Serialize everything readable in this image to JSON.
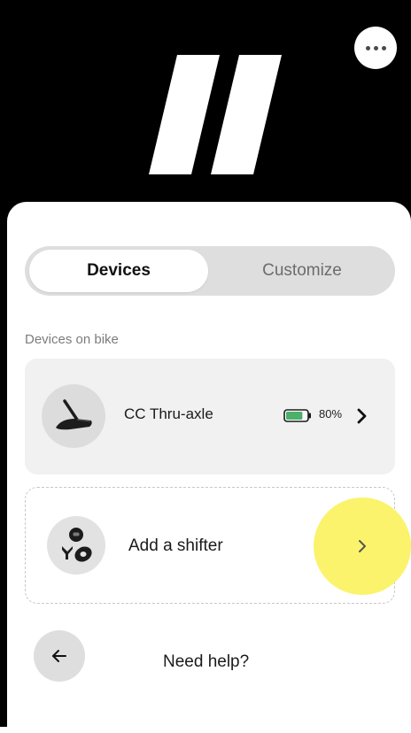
{
  "header": {
    "more_icon": "more-horizontal-icon",
    "logo_icon": "brand-logo-icon"
  },
  "tabs": {
    "items": [
      {
        "label": "Devices",
        "active": true
      },
      {
        "label": "Customize",
        "active": false
      }
    ]
  },
  "devices_section": {
    "label": "Devices on bike",
    "devices": [
      {
        "name": "CC Thru-axle",
        "battery_percent": 80,
        "battery_text": "80%",
        "icon": "thru-axle-icon"
      }
    ]
  },
  "add_device": {
    "label": "Add a shifter",
    "icon": "shifter-icon"
  },
  "footer": {
    "help_label": "Need help?",
    "back_icon": "arrow-left-icon"
  },
  "colors": {
    "header_bg": "#000000",
    "battery_fill": "#4caf6a",
    "highlight": "#fbf36b",
    "tab_track": "#dedede"
  }
}
